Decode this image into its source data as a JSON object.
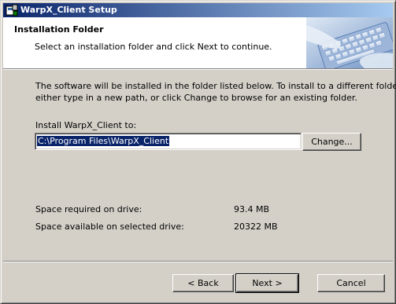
{
  "window": {
    "title": "WarpX_Client Setup"
  },
  "banner": {
    "title": "Installation Folder",
    "subtitle": "Select an installation folder and click Next to continue.",
    "image_icon": "keyboard-hand-image"
  },
  "body": {
    "description_line1": "The software will be installed in the folder listed below. To install to a different folder,",
    "description_line2": "either type in a new path, or click Change to browse for an existing folder.",
    "install_label": "Install WarpX_Client to:",
    "install_path": "C:\\Program Files\\WarpX_Client",
    "change_button": "Change...",
    "space_required_label": "Space required on drive:",
    "space_required_value": "93.4 MB",
    "space_available_label": "Space available on selected drive:",
    "space_available_value": "20322 MB"
  },
  "footer": {
    "back_button": "< Back",
    "next_button": "Next >",
    "cancel_button": "Cancel"
  },
  "colors": {
    "titlebar_start": "#0a246a",
    "titlebar_end": "#a6caf0",
    "dialog_bg": "#d4d0c8",
    "selection": "#0a246a"
  }
}
